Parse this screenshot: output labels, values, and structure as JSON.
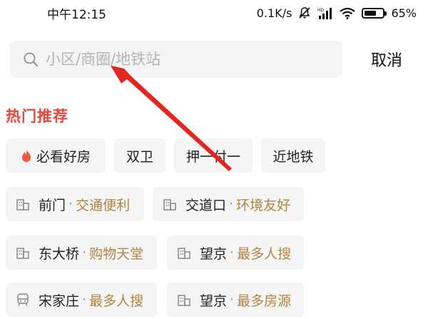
{
  "status_bar": {
    "time": "中午12:15",
    "network_speed": "0.1K/s",
    "battery_level": 65,
    "battery_label": "65%"
  },
  "search": {
    "placeholder": "小区/商圈/地铁站",
    "icon": "search-icon",
    "cancel_label": "取消"
  },
  "hot": {
    "title": "热门推荐",
    "quick_tags": [
      {
        "label": "必看好房",
        "icon": "flame-icon"
      },
      {
        "label": "双卫"
      },
      {
        "label": "押一付一"
      },
      {
        "label": "近地铁"
      }
    ],
    "areas": [
      {
        "name": "前门",
        "tag": "交通便利",
        "icon": "building-icon"
      },
      {
        "name": "交道口",
        "tag": "环境友好",
        "icon": "building-icon"
      },
      {
        "name": "东大桥",
        "tag": "购物天堂",
        "icon": "building-icon"
      },
      {
        "name": "望京",
        "tag": "最多人搜",
        "icon": "building-icon"
      },
      {
        "name": "宋家庄",
        "tag": "最多人搜",
        "icon": "subway-icon"
      },
      {
        "name": "望京",
        "tag": "最多房源",
        "icon": "building-icon"
      }
    ]
  },
  "colors": {
    "accent_red": "#e8453c",
    "tag_gold": "#b08440",
    "annotation_arrow": "#e32620"
  }
}
